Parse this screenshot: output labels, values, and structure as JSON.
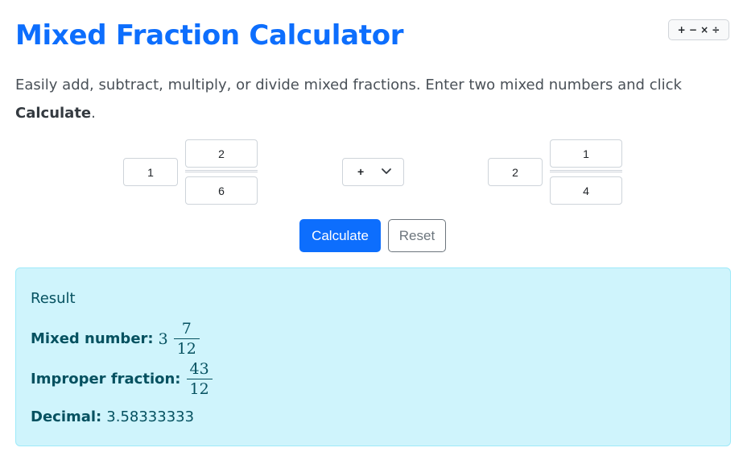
{
  "header": {
    "title": "Mixed Fraction Calculator",
    "ops_badge": "+ − × ÷"
  },
  "intro": {
    "text": "Easily add, subtract, multiply, or divide mixed fractions. Enter two mixed numbers and click ",
    "bold": "Calculate",
    "end": "."
  },
  "inputs": {
    "first": {
      "whole": "1",
      "numerator": "2",
      "denominator": "6"
    },
    "operator": {
      "selected": "+",
      "options": [
        "+",
        "−",
        "×",
        "÷"
      ]
    },
    "second": {
      "whole": "2",
      "numerator": "1",
      "denominator": "4"
    }
  },
  "buttons": {
    "calculate": "Calculate",
    "reset": "Reset"
  },
  "result": {
    "heading": "Result",
    "mixed_label": "Mixed number:",
    "mixed_whole": "3",
    "mixed_num": "7",
    "mixed_den": "12",
    "improper_label": "Improper fraction:",
    "improper_num": "43",
    "improper_den": "12",
    "decimal_label": "Decimal:",
    "decimal_value": "3.58333333"
  },
  "colors": {
    "accent": "#0d6efd",
    "result_bg": "#cff4fc",
    "result_text": "#055160"
  }
}
